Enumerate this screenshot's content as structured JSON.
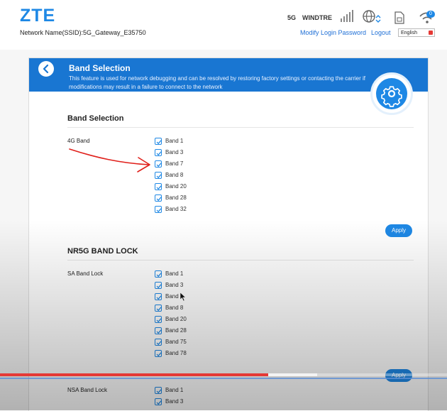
{
  "header": {
    "logo": "ZTE",
    "ssid": "Network Name(SSID):5G_Gateway_E35750",
    "network_type": "5G",
    "carrier": "WINDTRE",
    "wifi_clients": "0",
    "modify_password": "Modify Login Password",
    "logout": "Logout",
    "language": "English"
  },
  "banner": {
    "title": "Band Selection",
    "description": "This feature is used for network debugging and can be resolved by restoring factory settings or contacting the carrier if modifications may result in a failure to connect to the network"
  },
  "band_selection": {
    "title": "Band Selection",
    "label": "4G Band",
    "bands": [
      {
        "label": "Band 1",
        "checked": true
      },
      {
        "label": "Band 3",
        "checked": true
      },
      {
        "label": "Band 7",
        "checked": true
      },
      {
        "label": "Band 8",
        "checked": true
      },
      {
        "label": "Band 20",
        "checked": true
      },
      {
        "label": "Band 28",
        "checked": true
      },
      {
        "label": "Band 32",
        "checked": true
      }
    ],
    "apply": "Apply"
  },
  "nr5g": {
    "title": "NR5G BAND LOCK",
    "sa_label": "SA Band Lock",
    "sa_bands": [
      {
        "label": "Band 1",
        "checked": true
      },
      {
        "label": "Band 3",
        "checked": true
      },
      {
        "label": "Band",
        "checked": true
      },
      {
        "label": "Band 8",
        "checked": true
      },
      {
        "label": "Band 20",
        "checked": true
      },
      {
        "label": "Band 28",
        "checked": true
      },
      {
        "label": "Band 75",
        "checked": true
      },
      {
        "label": "Band 78",
        "checked": true
      }
    ],
    "apply": "Apply",
    "nsa_label": "NSA Band Lock",
    "nsa_bands": [
      {
        "label": "Band 1",
        "checked": true
      },
      {
        "label": "Band 3",
        "checked": true
      }
    ]
  },
  "video": {
    "played_fraction": 0.6,
    "buffered_fraction": 0.71
  },
  "colors": {
    "accent": "#1e88e5",
    "banner": "#1976d2",
    "annotation": "#e0201b",
    "progress": "#e53935"
  }
}
